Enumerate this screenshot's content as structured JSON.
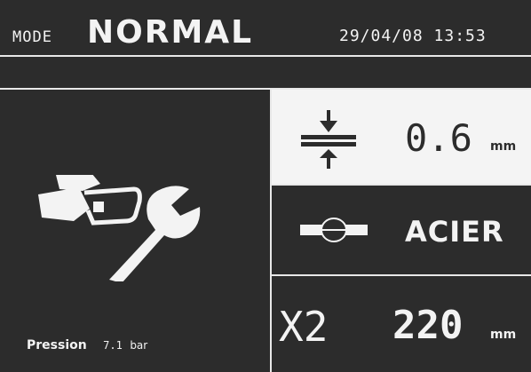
{
  "header": {
    "mode_label": "MODE",
    "mode_value": "NORMAL",
    "datetime": "29/04/08 13:53"
  },
  "status": {
    "pressure_label": "Pression",
    "pressure_value": "7.1",
    "pressure_unit": "bar"
  },
  "thickness": {
    "icon": "sheet-thickness-icon",
    "value": "0.6",
    "unit": "mm"
  },
  "material": {
    "icon": "material-section-icon",
    "value": "ACIER"
  },
  "electrode": {
    "multiplier": "X2",
    "value": "220",
    "unit": "mm"
  },
  "colors": {
    "background": "#2c2c2c",
    "foreground": "#f3f3f3",
    "highlight_cell": "#f4f4f4"
  }
}
